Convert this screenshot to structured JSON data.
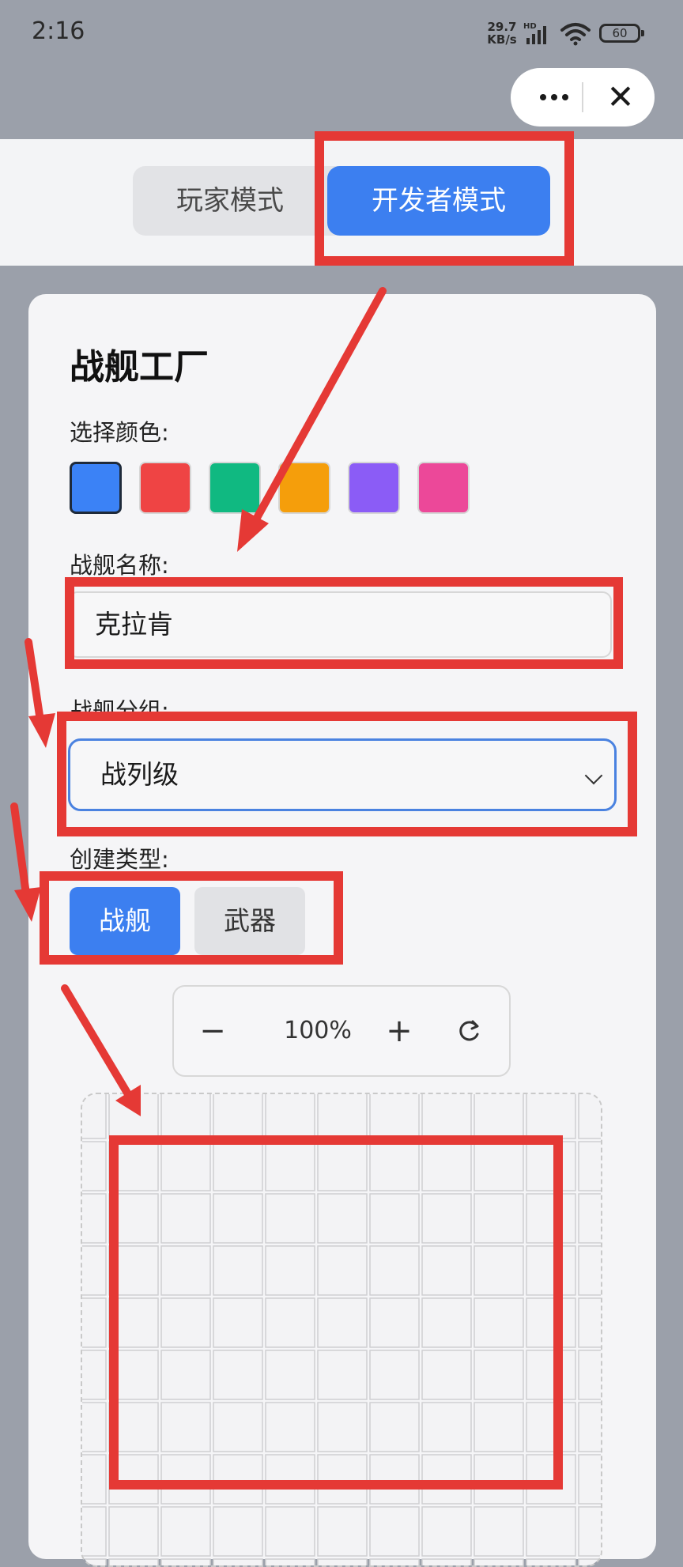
{
  "status_bar": {
    "time": "2:16",
    "net_speed_value": "29.7",
    "net_speed_unit": "KB/s",
    "network_badge": "HD",
    "battery": "60"
  },
  "capsule": {
    "more_icon": "more-dots-icon",
    "close_icon": "close-icon"
  },
  "mode_tabs": [
    {
      "label": "玩家模式",
      "active": false
    },
    {
      "label": "开发者模式",
      "active": true
    }
  ],
  "card": {
    "title": "战舰工厂",
    "color_label": "选择颜色:",
    "colors": [
      "#3b82f6",
      "#ef4444",
      "#10b981",
      "#f59e0b",
      "#8b5cf6",
      "#ec4899"
    ],
    "selected_color_index": 0,
    "name_label": "战舰名称:",
    "name_value": "克拉肯",
    "group_label": "战舰分组:",
    "group_value": "战列级",
    "type_label": "创建类型:",
    "type_options": [
      {
        "label": "战舰",
        "active": true
      },
      {
        "label": "武器",
        "active": false
      }
    ],
    "zoom": {
      "minus": "−",
      "value": "100%",
      "plus": "+",
      "reset_icon": "refresh-icon"
    }
  },
  "annotation_color": "#e53935",
  "accent_color": "#3c7ff0"
}
